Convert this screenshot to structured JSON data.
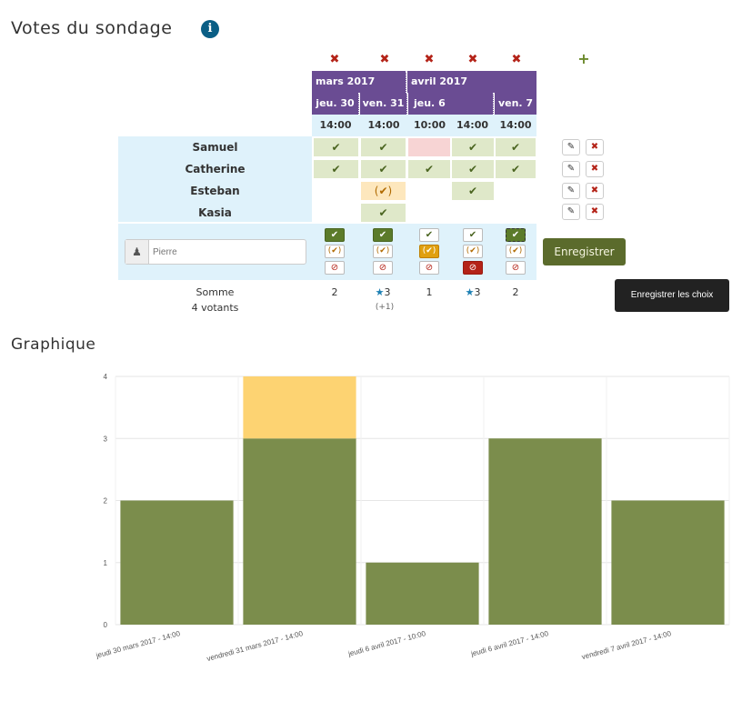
{
  "poll": {
    "title": "Votes du sondage",
    "add_icon": "+",
    "months": [
      {
        "label": "mars 2017"
      },
      {
        "label": "avril 2017"
      }
    ],
    "days": [
      "jeu. 30",
      "ven. 31",
      "jeu. 6",
      "ven. 7"
    ],
    "times": [
      "14:00",
      "14:00",
      "10:00",
      "14:00",
      "14:00"
    ],
    "participants": [
      {
        "name": "Samuel",
        "votes": [
          "yes",
          "yes",
          "no",
          "yes",
          "yes"
        ]
      },
      {
        "name": "Catherine",
        "votes": [
          "yes",
          "yes",
          "yes",
          "yes",
          "yes"
        ]
      },
      {
        "name": "Esteban",
        "votes": [
          "",
          "maybe",
          "",
          "yes",
          ""
        ]
      },
      {
        "name": "Kasia",
        "votes": [
          "",
          "yes",
          "",
          "",
          ""
        ]
      }
    ],
    "symbols": {
      "yes": "✔",
      "maybe": "(✔)",
      "no": "⊘",
      "edit": "✎",
      "delete": "✖"
    },
    "new_vote": {
      "placeholder": "Pierre",
      "selected": [
        "yes",
        "yes",
        "maybe",
        "no",
        "yes"
      ]
    },
    "save_label": "Enregistrer",
    "tooltip": "Enregistrer les choix",
    "sum_label": "Somme",
    "voters_label": "4 votants",
    "sums": [
      "2",
      "3",
      "1",
      "3",
      "2"
    ],
    "best": [
      false,
      true,
      false,
      true,
      false
    ],
    "sum_extra": "(+1)"
  },
  "chart_title": "Graphique",
  "chart_data": {
    "type": "bar",
    "stacked": true,
    "categories": [
      "jeudi 30 mars 2017 - 14:00",
      "vendredi 31 mars 2017 - 14:00",
      "jeudi 6 avril 2017 - 10:00",
      "jeudi 6 avril 2017 - 14:00",
      "vendredi 7 avril 2017 - 14:00"
    ],
    "series": [
      {
        "values": [
          2,
          3,
          1,
          3,
          2
        ],
        "color": "#7b8d4c"
      },
      {
        "values": [
          0,
          1,
          0,
          0,
          0
        ],
        "color": "#fdd372"
      }
    ],
    "yticks": [
      "0",
      "1",
      "2",
      "3",
      "4"
    ],
    "ylim": [
      0,
      4
    ],
    "grid": true
  }
}
